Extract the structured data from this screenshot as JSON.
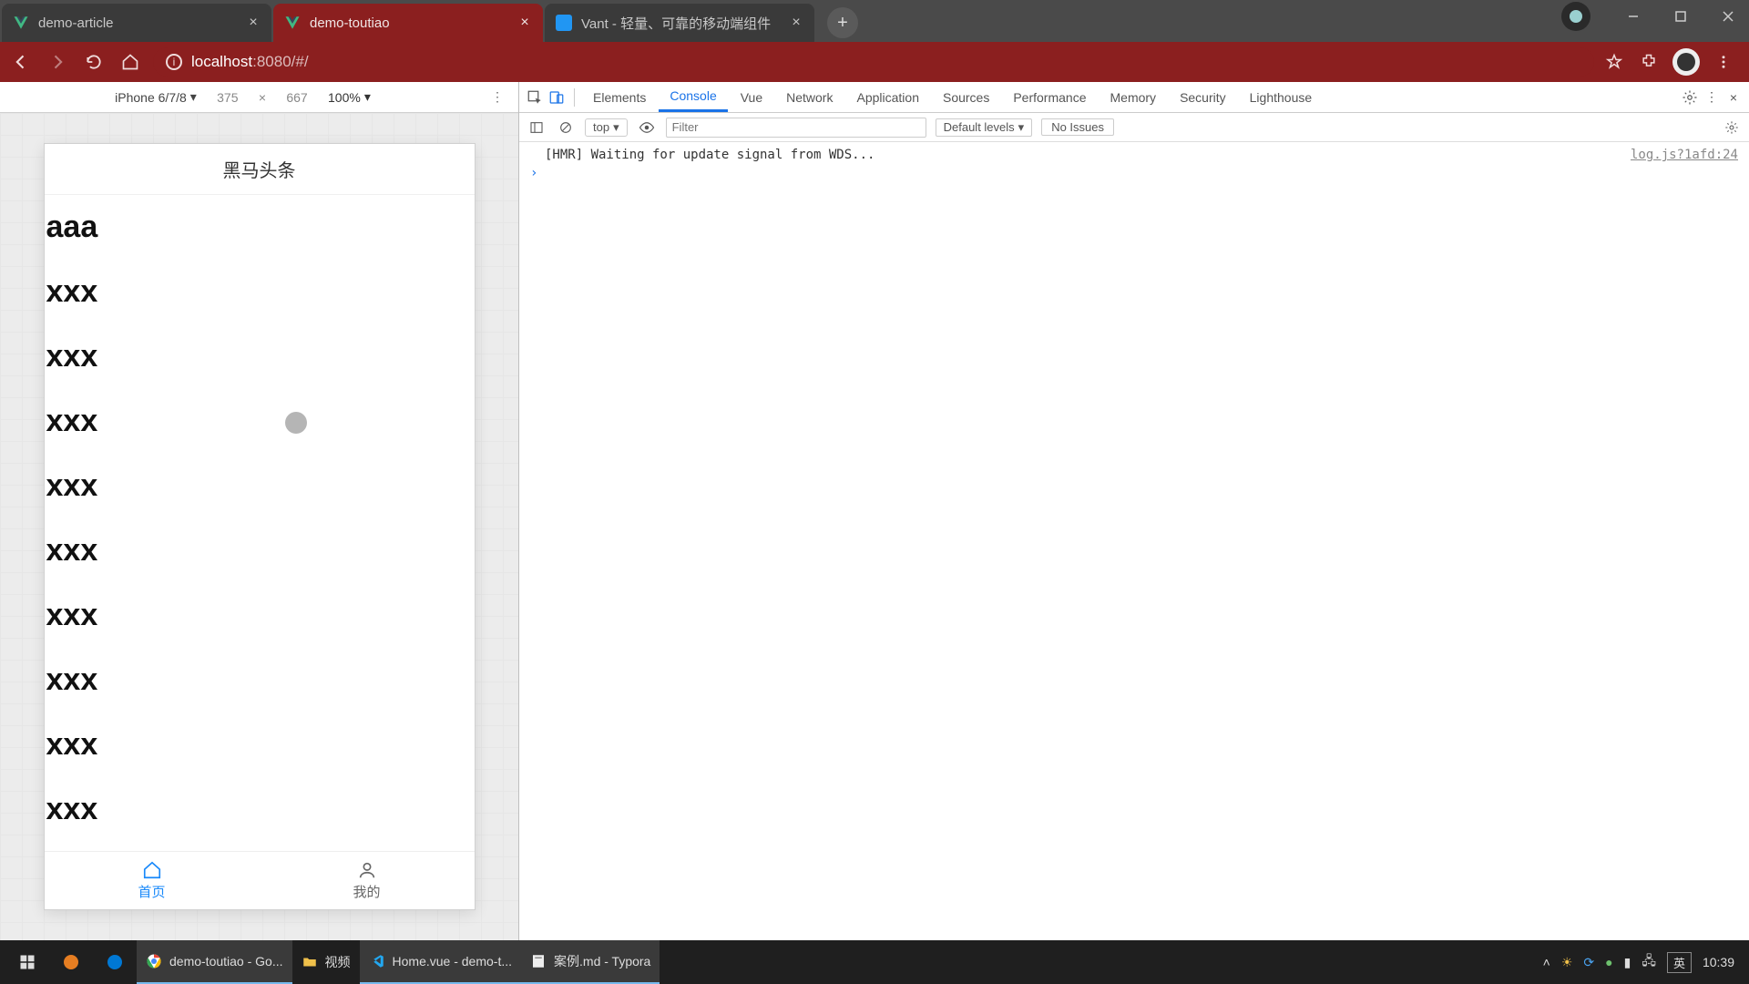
{
  "browser": {
    "tabs": [
      {
        "title": "demo-article",
        "active": false,
        "favicon": "vue"
      },
      {
        "title": "demo-toutiao",
        "active": true,
        "favicon": "vue"
      },
      {
        "title": "Vant - 轻量、可靠的移动端组件",
        "active": false,
        "favicon": "vant"
      }
    ],
    "url_host": "localhost",
    "url_port_path": ":8080/#/"
  },
  "device_toolbar": {
    "device": "iPhone 6/7/8",
    "width": "375",
    "height": "667",
    "zoom": "100%"
  },
  "app": {
    "navbar_title": "黑马头条",
    "list": [
      "aaa",
      "xxx",
      "xxx",
      "xxx",
      "xxx",
      "xxx",
      "xxx",
      "xxx",
      "xxx",
      "xxx"
    ],
    "tabbar": [
      {
        "label": "首页",
        "active": true
      },
      {
        "label": "我的",
        "active": false
      }
    ]
  },
  "devtools": {
    "tabs": [
      "Elements",
      "Console",
      "Vue",
      "Network",
      "Application",
      "Sources",
      "Performance",
      "Memory",
      "Security",
      "Lighthouse"
    ],
    "active_tab": "Console",
    "console": {
      "context": "top",
      "filter_placeholder": "Filter",
      "levels": "Default levels",
      "issues": "No Issues",
      "log_text": "[HMR] Waiting for update signal from WDS...",
      "log_src": "log.js?1afd:24"
    }
  },
  "taskbar": {
    "items": [
      {
        "label": "demo-toutiao - Go...",
        "icon": "chrome",
        "active": true
      },
      {
        "label": "视频",
        "icon": "folder",
        "active": false
      },
      {
        "label": "Home.vue - demo-t...",
        "icon": "vscode",
        "active": true
      },
      {
        "label": "案例.md - Typora",
        "icon": "typora",
        "active": true
      }
    ],
    "ime": "英",
    "clock": "10:39"
  }
}
